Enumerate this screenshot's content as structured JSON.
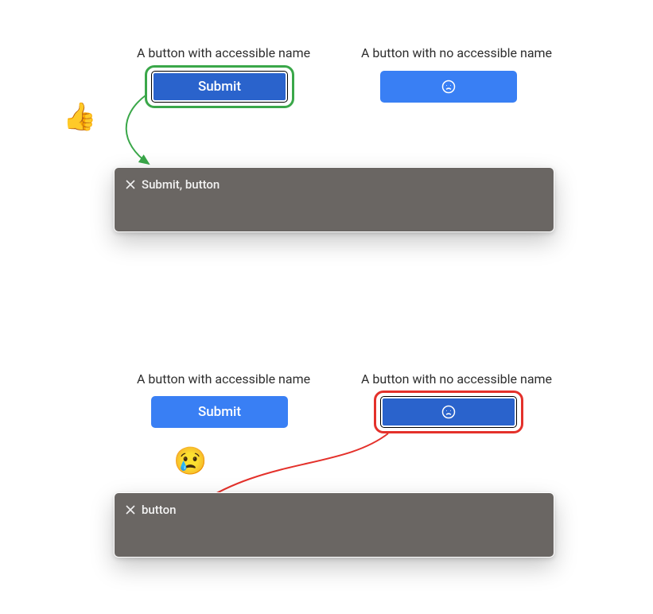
{
  "top": {
    "left_label": "A button with accessible name",
    "right_label": "A button with no accessible name",
    "submit_label": "Submit",
    "reader_text": "Submit, button",
    "emoji": "👍"
  },
  "bottom": {
    "left_label": "A button with accessible name",
    "right_label": "A button with no accessible name",
    "submit_label": "Submit",
    "reader_text": "button",
    "emoji": "😢"
  },
  "colors": {
    "button_bg": "#397ff4",
    "button_selected_bg": "#2a63cc",
    "highlight_good": "#3aa749",
    "highlight_bad": "#e4312b",
    "reader_bg": "#6a6663"
  },
  "icons": {
    "unnamed_button": "sad-face-icon",
    "reader_close": "close-icon"
  }
}
